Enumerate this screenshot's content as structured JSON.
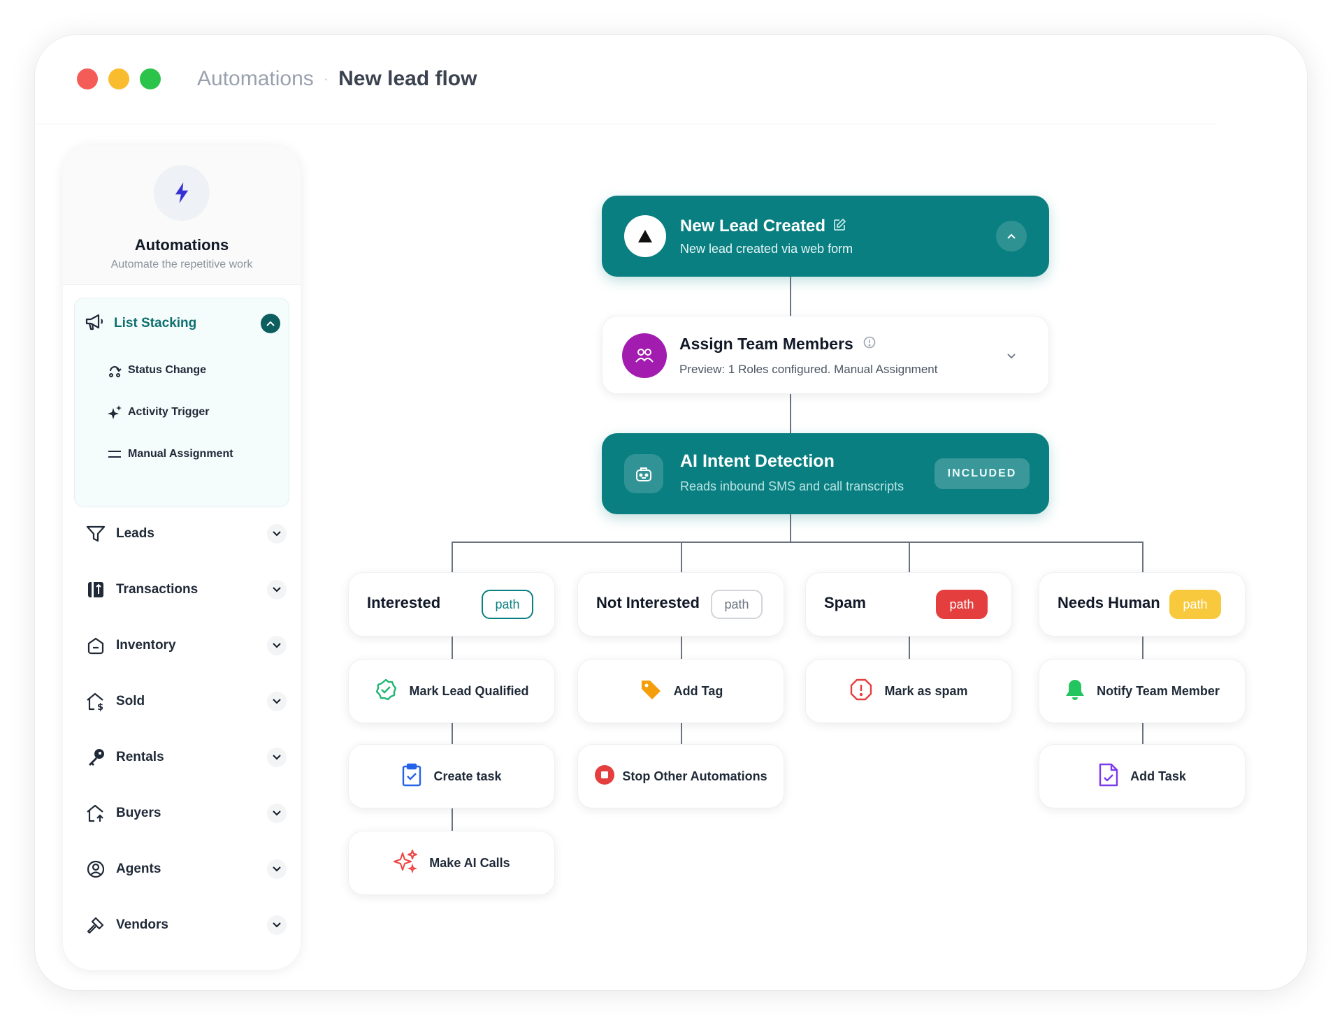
{
  "window": {
    "breadcrumb": {
      "parent": "Automations",
      "separator": "·",
      "current": "New lead flow"
    }
  },
  "sidebar": {
    "title": "Automations",
    "subtitle": "Automate the repetitive work",
    "expanded_group": {
      "label": "List Stacking",
      "items": [
        {
          "label": "Status Change",
          "icon": "status-change-icon"
        },
        {
          "label": "Activity Trigger",
          "icon": "sparkle-icon"
        },
        {
          "label": "Manual Assignment",
          "icon": "lines-icon"
        }
      ]
    },
    "nav_items": [
      {
        "label": "Leads",
        "icon": "funnel-icon"
      },
      {
        "label": "Transactions",
        "icon": "transactions-icon"
      },
      {
        "label": "Inventory",
        "icon": "inventory-icon"
      },
      {
        "label": "Sold",
        "icon": "house-dollar-icon"
      },
      {
        "label": "Rentals",
        "icon": "key-icon"
      },
      {
        "label": "Buyers",
        "icon": "house-up-icon"
      },
      {
        "label": "Agents",
        "icon": "agent-icon"
      },
      {
        "label": "Vendors",
        "icon": "hammer-icon"
      }
    ]
  },
  "flow": {
    "trigger": {
      "title": "New Lead Created",
      "subtitle": "New lead created via web form"
    },
    "assign": {
      "title": "Assign Team Members",
      "subtitle": "Preview: 1 Roles configured. Manual Assignment"
    },
    "ai": {
      "title": "AI Intent Detection",
      "subtitle": "Reads inbound SMS and call transcripts",
      "badge": "INCLUDED"
    },
    "branches": [
      {
        "name": "Interested",
        "pill": "path",
        "actions": [
          "Mark Lead Qualified",
          "Create task",
          "Make AI Calls"
        ]
      },
      {
        "name": "Not Interested",
        "pill": "path",
        "actions": [
          "Add Tag",
          "Stop Other Automations"
        ]
      },
      {
        "name": "Spam",
        "pill": "path",
        "actions": [
          "Mark as spam"
        ]
      },
      {
        "name": "Needs Human",
        "pill": "path",
        "actions": [
          "Notify Team Member",
          "Add Task"
        ]
      }
    ]
  },
  "colors": {
    "teal": "#0a7f81",
    "purple": "#a21caf",
    "red": "#e53e3e",
    "yellow": "#f8c93c"
  }
}
